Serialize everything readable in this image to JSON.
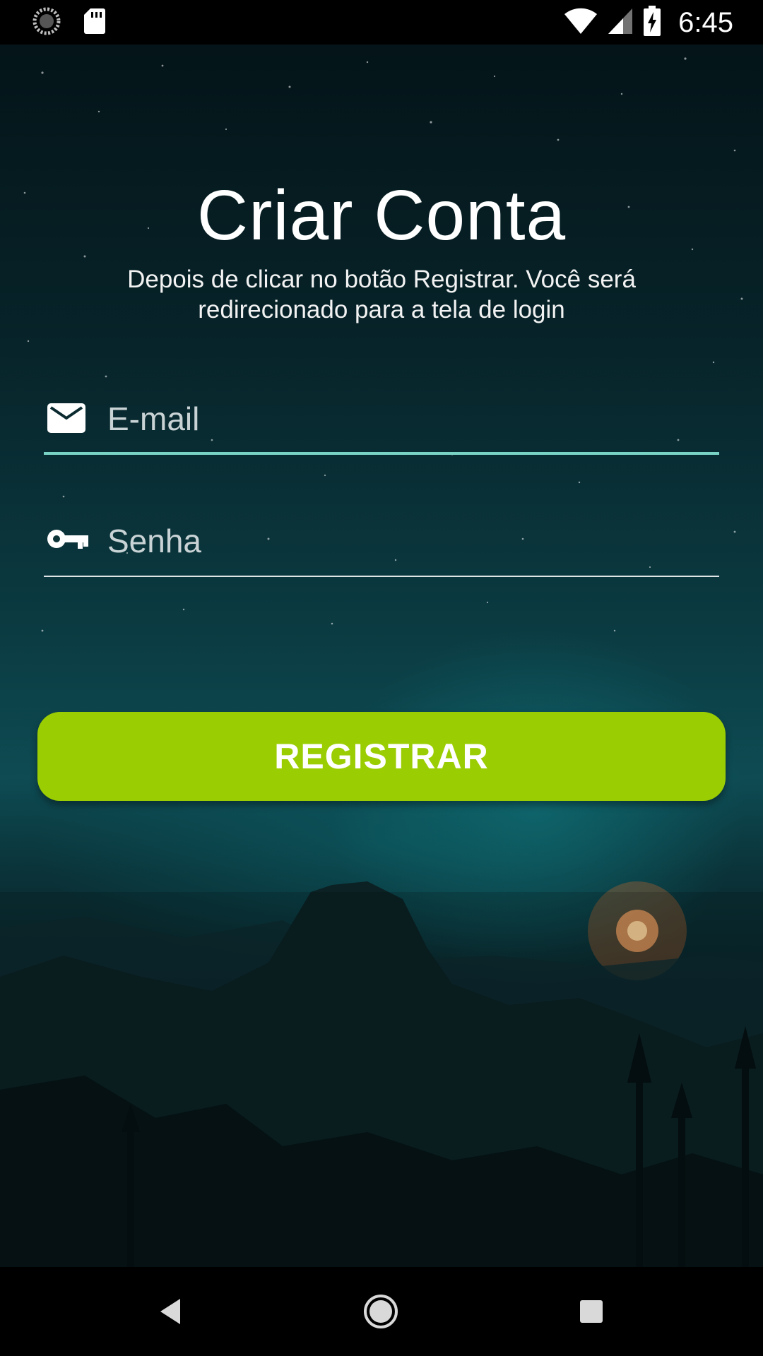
{
  "status_bar": {
    "time": "6:45",
    "icons": [
      "loading-icon",
      "sd-card-icon",
      "wifi-icon",
      "signal-icon",
      "battery-charging-icon"
    ]
  },
  "screen": {
    "title": "Criar Conta",
    "subtitle": "Depois de clicar no botão Registrar. Você será redirecionado para a tela de login"
  },
  "form": {
    "email": {
      "placeholder": "E-mail",
      "value": "",
      "icon": "mail-icon"
    },
    "password": {
      "placeholder": "Senha",
      "value": "",
      "icon": "key-icon"
    },
    "register_label": "REGISTRAR"
  },
  "nav_bar": {
    "icons": [
      "back-icon",
      "home-icon",
      "recents-icon"
    ]
  },
  "colors": {
    "button": "#9bcd03",
    "email_underline": "#79d3c4",
    "background_dark": "#041418",
    "background_teal": "#0e4b53"
  }
}
